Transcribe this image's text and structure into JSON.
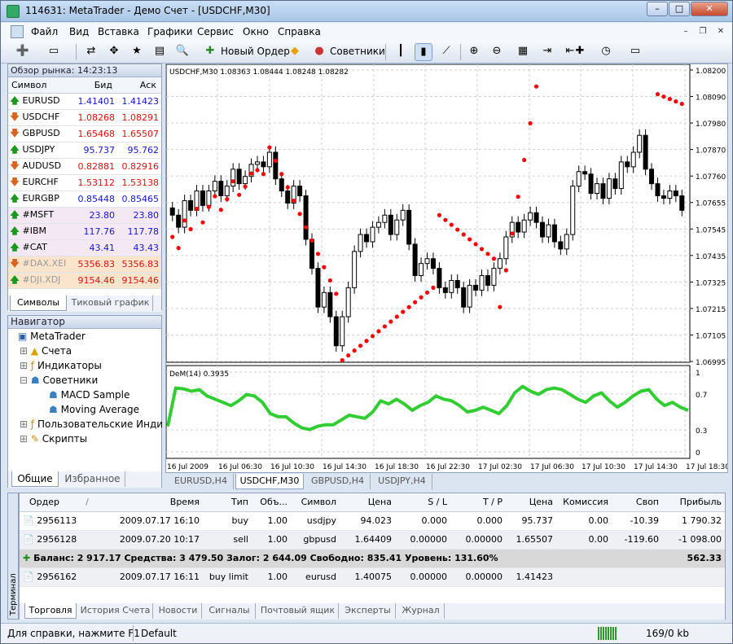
{
  "window": {
    "title": "114631: MetaTrader - Демо Счет - [USDCHF,M30]"
  },
  "menu": [
    "Файл",
    "Вид",
    "Вставка",
    "Графики",
    "Сервис",
    "Окно",
    "Справка"
  ],
  "toolbar": {
    "new_order": "Новый Ордер",
    "experts": "Советники"
  },
  "market_watch": {
    "title": "Обзор рынка: 14:23:13",
    "headers": [
      "Символ",
      "Бид",
      "Аск"
    ],
    "rows": [
      {
        "symbol": "EURUSD",
        "bid": "1.41401",
        "ask": "1.41423",
        "dir": "up"
      },
      {
        "symbol": "USDCHF",
        "bid": "1.08268",
        "ask": "1.08291",
        "dir": "down"
      },
      {
        "symbol": "GBPUSD",
        "bid": "1.65468",
        "ask": "1.65507",
        "dir": "down"
      },
      {
        "symbol": "USDJPY",
        "bid": "95.737",
        "ask": "95.762",
        "dir": "up"
      },
      {
        "symbol": "AUDUSD",
        "bid": "0.82881",
        "ask": "0.82916",
        "dir": "down"
      },
      {
        "symbol": "EURCHF",
        "bid": "1.53112",
        "ask": "1.53138",
        "dir": "down"
      },
      {
        "symbol": "EURGBP",
        "bid": "0.85448",
        "ask": "0.85465",
        "dir": "up"
      },
      {
        "symbol": "#MSFT",
        "bid": "23.80",
        "ask": "23.80",
        "dir": "up"
      },
      {
        "symbol": "#IBM",
        "bid": "117.76",
        "ask": "117.78",
        "dir": "up"
      },
      {
        "symbol": "#CAT",
        "bid": "43.41",
        "ask": "43.43",
        "dir": "up"
      },
      {
        "symbol": "#DAX.XEI",
        "bid": "5356.83",
        "ask": "5356.83",
        "dir": "down"
      },
      {
        "symbol": "#DJI.XDJ",
        "bid": "9154.46",
        "ask": "9154.46",
        "dir": "up"
      }
    ],
    "tabs": [
      "Символы",
      "Тиковый график"
    ]
  },
  "navigator": {
    "title": "Навигатор",
    "items": [
      "MetaTrader",
      "Счета",
      "Индикаторы",
      "Советники",
      "MACD Sample",
      "Moving Average",
      "Пользовательские Инди",
      "Скрипты"
    ],
    "tabs": [
      "Общие",
      "Избранное"
    ]
  },
  "chart": {
    "info": "USDCHF,M30  1.08363 1.08444 1.08248 1.08282",
    "indicator_info": "DeM(14) 0.3935",
    "price_ticks": [
      "1.08200",
      "1.08090",
      "1.07980",
      "1.07870",
      "1.07760",
      "1.07655",
      "1.07545",
      "1.07435",
      "1.07325",
      "1.07215",
      "1.07105",
      "1.06995"
    ],
    "ind_ticks": [
      "1",
      "0.7",
      "0.3",
      "0"
    ],
    "time_ticks": [
      "16 Jul 2009",
      "16 Jul 06:30",
      "16 Jul 10:30",
      "16 Jul 14:30",
      "16 Jul 18:30",
      "16 Jul 22:30",
      "17 Jul 02:30",
      "17 Jul 06:30",
      "17 Jul 10:30",
      "17 Jul 14:30",
      "17 Jul 18:30"
    ],
    "tabs": [
      "EURUSD,H4",
      "USDCHF,M30",
      "GBPUSD,H4",
      "USDJPY,H4"
    ]
  },
  "terminal": {
    "side_label": "Терминал",
    "headers": [
      "Ордер",
      "/",
      "Время",
      "Тип",
      "Объ...",
      "Символ",
      "Цена",
      "S / L",
      "T / P",
      "Цена",
      "Комиссия",
      "Своп",
      "Прибыль"
    ],
    "rows": [
      [
        "2956113",
        "2009.07.17 16:10",
        "buy",
        "1.00",
        "usdjpy",
        "94.023",
        "0.000",
        "0.000",
        "95.737",
        "0.00",
        "-10.39",
        "1 790.32"
      ],
      [
        "2956128",
        "2009.07.20 10:17",
        "sell",
        "1.00",
        "gbpusd",
        "1.64409",
        "0.00000",
        "0.00000",
        "1.65507",
        "0.00",
        "-119.60",
        "-1 098.00"
      ]
    ],
    "balance": "Баланс: 2 917.17  Средства: 3 479.50  Залог: 2 644.09  Свободно: 835.41  Уровень: 131.60%",
    "balance_total": "562.33",
    "pending": [
      "2956162",
      "2009.07.17 16:11",
      "buy limit",
      "1.00",
      "eurusd",
      "1.40075",
      "0.00000",
      "0.00000",
      "1.41423"
    ],
    "tabs": [
      "Торговля",
      "История Счета",
      "Новости",
      "Сигналы",
      "Почтовый ящик",
      "Эксперты",
      "Журнал"
    ]
  },
  "status": {
    "help": "Для справки, нажмите F1",
    "profile": "Default",
    "traffic": "169/0 kb"
  }
}
